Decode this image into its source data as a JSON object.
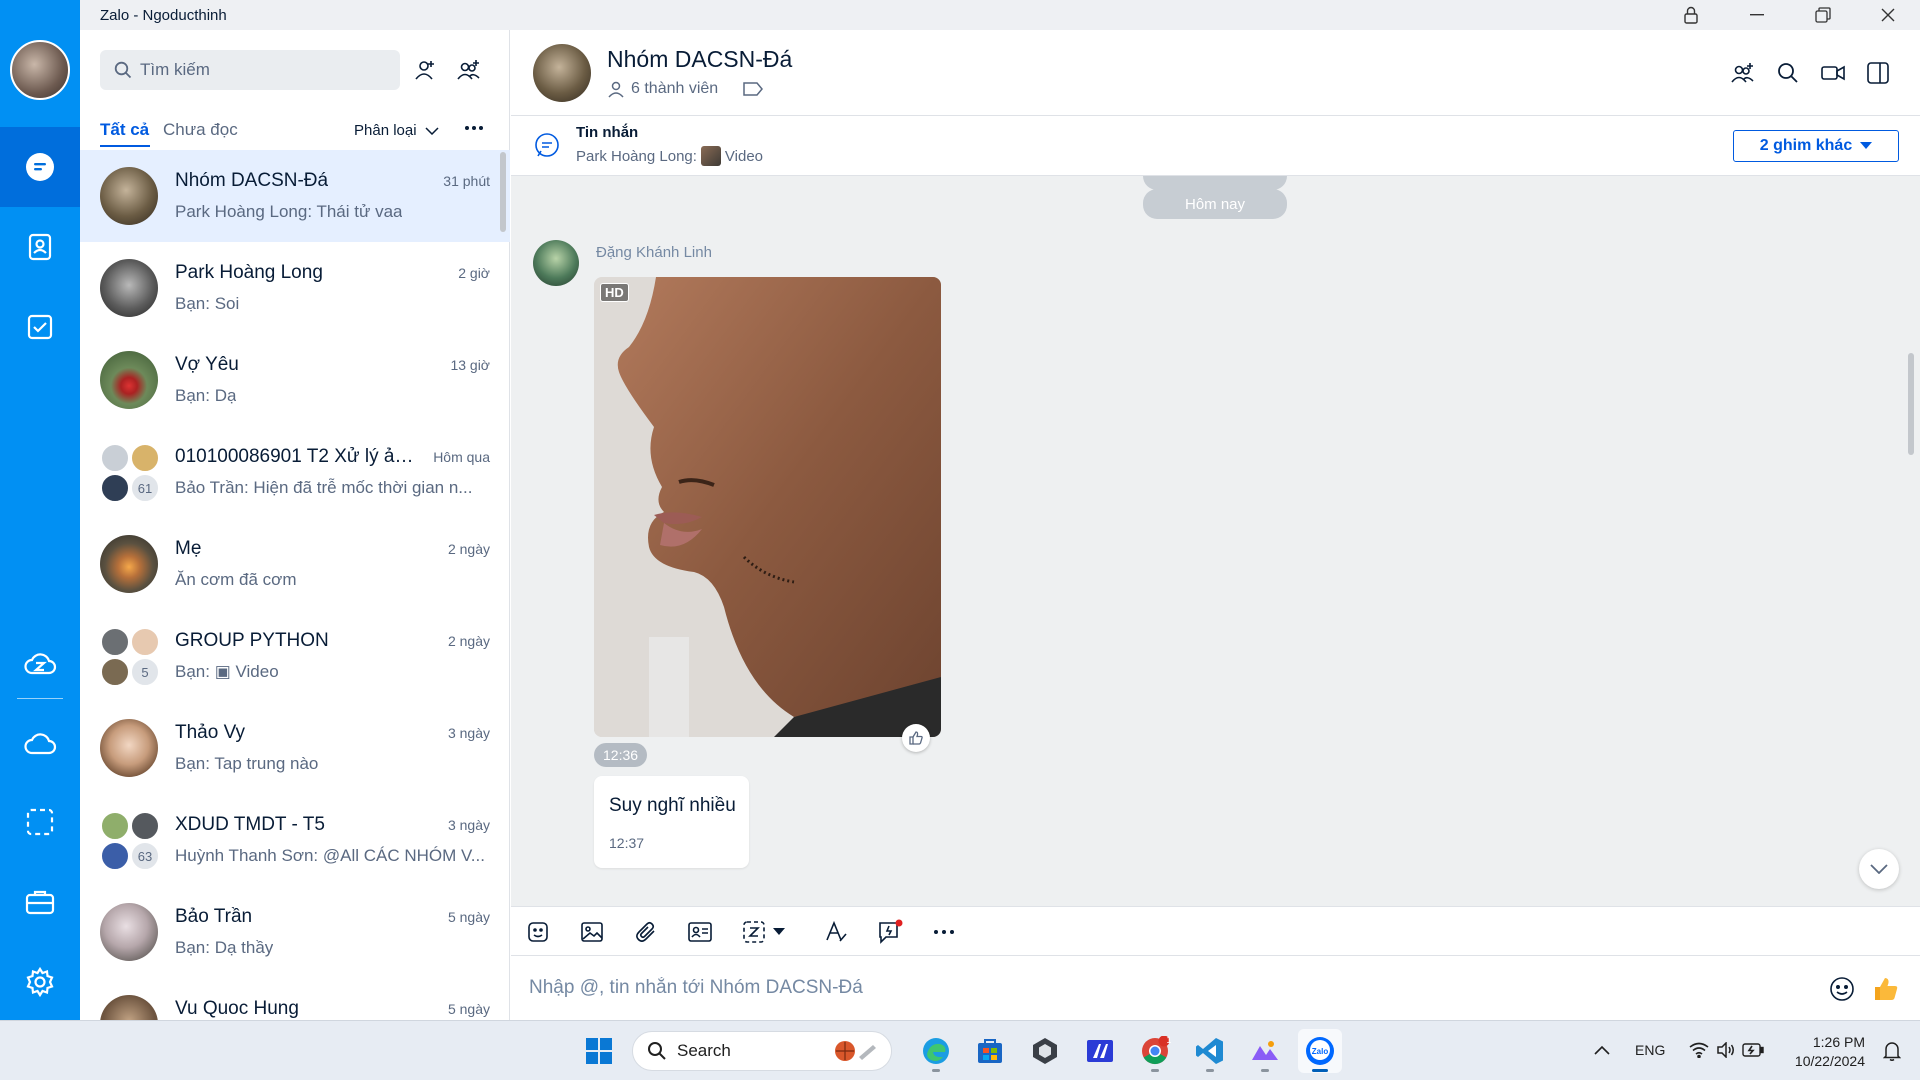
{
  "window": {
    "title": "Zalo - Ngoducthinh"
  },
  "search": {
    "placeholder": "Tìm kiếm"
  },
  "filters": {
    "all": "Tất cả",
    "unread": "Chưa đọc",
    "classify": "Phân loại"
  },
  "conversations": [
    {
      "name": "Nhóm DACSN-Đá",
      "time": "31 phút",
      "preview": "Park Hoàng Long: Thái tử vaa"
    },
    {
      "name": "Park Hoàng Long",
      "time": "2 giờ",
      "preview": "Bạn: Soi"
    },
    {
      "name": "Vợ Yêu",
      "time": "13 giờ",
      "preview": "Bạn: Dạ"
    },
    {
      "name": "010100086901 T2 Xử lý ản...",
      "time": "Hôm qua",
      "preview": "Bảo Trần: Hiện đã trễ mốc thời gian n...",
      "count": "61"
    },
    {
      "name": "Mẹ",
      "time": "2 ngày",
      "preview": "Ăn cơm đã cơm"
    },
    {
      "name": "GROUP PYTHON",
      "time": "2 ngày",
      "preview": "Bạn: ▣ Video",
      "count": "5"
    },
    {
      "name": "Thảo Vy",
      "time": "3 ngày",
      "preview": "Bạn: Tap trung nào"
    },
    {
      "name": "XDUD TMDT - T5",
      "time": "3 ngày",
      "preview": "Huỳnh Thanh Sơn: @All CÁC NHÓM V...",
      "count": "63"
    },
    {
      "name": "Bảo Trần",
      "time": "5 ngày",
      "preview": "Bạn: Dạ thầy"
    },
    {
      "name": "Vu Quoc Hung",
      "time": "5 ngày",
      "preview": ""
    }
  ],
  "chat": {
    "group_name": "Nhóm DACSN-Đá",
    "members": "6 thành viên",
    "pinned": {
      "title": "Tin nhắn",
      "sender": "Park Hoàng Long:",
      "content": "Video",
      "more": "2 ghim khác"
    },
    "date_separator": "Hôm nay",
    "messages": {
      "sender": "Đặng Khánh Linh",
      "photo_badge": "HD",
      "photo_time": "12:36",
      "text": "Suy nghĩ nhiều",
      "text_time": "12:37"
    },
    "composer_placeholder": "Nhập @, tin nhắn tới Nhóm DACSN-Đá"
  },
  "taskbar": {
    "search_label": "Search",
    "language": "ENG",
    "time": "1:26 PM",
    "date": "10/22/2024",
    "chrome_badge": "1",
    "zalo_label": "Zalo"
  },
  "colors": {
    "nav_blue": "#0190f3",
    "accent": "#005ae0",
    "active_row": "#e5efff"
  }
}
